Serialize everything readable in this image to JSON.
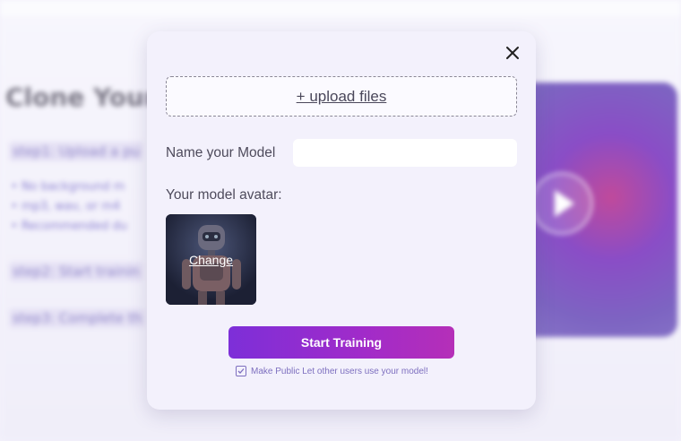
{
  "background": {
    "title": "Clone Your",
    "steps": [
      "step1: Upload a pu",
      "step2: Start trainin",
      "step3: Complete th"
    ],
    "bullets": [
      "No background m",
      "mp3, wav, or m4",
      "Recommended du"
    ],
    "video_play_icon": "play-icon"
  },
  "modal": {
    "close_icon": "close-icon",
    "upload_label": "+ upload files",
    "name_label": "Name your Model",
    "name_value": "",
    "avatar_label": "Your model avatar:",
    "avatar_change_label": "Change",
    "start_button_label": "Start Training",
    "make_public_label": "Make Public Let other users use your model!",
    "make_public_checked": true
  },
  "colors": {
    "accent_start": "#7d2fd8",
    "accent_end": "#b52fb8",
    "modal_bg": "#f3f1fc",
    "checkbox_text": "#7d6fbf"
  }
}
